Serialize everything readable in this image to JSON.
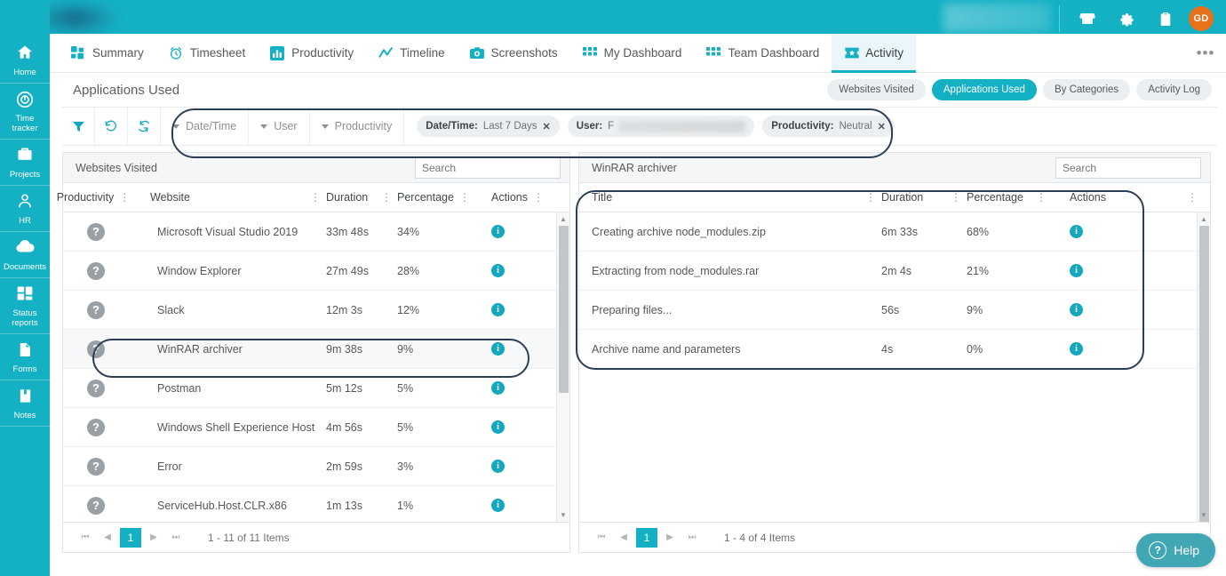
{
  "app": {
    "brand_color": "#14b0c4",
    "accent_color": "#13a8bd",
    "avatar_initials": "GD"
  },
  "topbar": {
    "icons": [
      {
        "name": "storefront-icon",
        "glyph": "⌂"
      },
      {
        "name": "gear-icon",
        "glyph": "⚙"
      },
      {
        "name": "clipboard-icon",
        "glyph": "ὌB"
      }
    ]
  },
  "sidebar": {
    "items": [
      {
        "label": "Home",
        "icon": "home-icon"
      },
      {
        "label": "Time tracker",
        "icon": "time-tracker-icon"
      },
      {
        "label": "Projects",
        "icon": "briefcase-icon"
      },
      {
        "label": "HR",
        "icon": "person-icon"
      },
      {
        "label": "Documents",
        "icon": "cloud-icon"
      },
      {
        "label": "Status reports",
        "icon": "grid-icon"
      },
      {
        "label": "Forms",
        "icon": "document-icon"
      },
      {
        "label": "Notes",
        "icon": "notebook-icon"
      }
    ]
  },
  "tabs": {
    "items": [
      {
        "label": "Summary",
        "icon": "grid-squares-icon",
        "active": false
      },
      {
        "label": "Timesheet",
        "icon": "alarm-clock-icon",
        "active": false
      },
      {
        "label": "Productivity",
        "icon": "bar-chart-icon",
        "active": false
      },
      {
        "label": "Timeline",
        "icon": "trend-line-icon",
        "active": false
      },
      {
        "label": "Screenshots",
        "icon": "camera-icon",
        "active": false
      },
      {
        "label": "My Dashboard",
        "icon": "dashboard-grid-icon",
        "active": false
      },
      {
        "label": "Team Dashboard",
        "icon": "dashboard-grid-icon",
        "active": false
      },
      {
        "label": "Activity",
        "icon": "activity-ticket-icon",
        "active": true
      }
    ],
    "more_label": "•••"
  },
  "page": {
    "title": "Applications Used",
    "view_toggles": [
      {
        "label": "Websites Visited",
        "active": false
      },
      {
        "label": "Applications Used",
        "active": true
      },
      {
        "label": "By Categories",
        "active": false
      },
      {
        "label": "Activity Log",
        "active": false
      }
    ]
  },
  "filterbar": {
    "buttons": [
      {
        "name": "filter-funnel-button",
        "icon": "funnel-icon"
      },
      {
        "name": "reset-button",
        "icon": "undo-icon"
      },
      {
        "name": "refresh-button",
        "icon": "refresh-icon"
      }
    ],
    "dropdowns": [
      {
        "label": "Date/Time"
      },
      {
        "label": "User"
      },
      {
        "label": "Productivity"
      }
    ],
    "chips": [
      {
        "key": "Date/Time:",
        "value": "Last 7 Days",
        "redacted": false,
        "remove": "✕"
      },
      {
        "key": "User:",
        "value": "F",
        "redacted": true,
        "remove": "✕"
      },
      {
        "key": "Productivity:",
        "value": "Neutral",
        "redacted": false,
        "remove": "✕"
      }
    ]
  },
  "left_panel": {
    "title": "Websites Visited",
    "search_placeholder": "Search",
    "search_value": "",
    "columns": [
      "Productivity",
      "Website",
      "Duration",
      "Percentage",
      "Actions"
    ],
    "rows": [
      {
        "productivity": "?",
        "website": "Microsoft Visual Studio 2019",
        "duration": "33m 48s",
        "percentage": "34%",
        "action": "i",
        "highlighted": false
      },
      {
        "productivity": "?",
        "website": "Window Explorer",
        "duration": "27m 49s",
        "percentage": "28%",
        "action": "i",
        "highlighted": false
      },
      {
        "productivity": "?",
        "website": "Slack",
        "duration": "12m 3s",
        "percentage": "12%",
        "action": "i",
        "highlighted": false
      },
      {
        "productivity": "?",
        "website": "WinRAR archiver",
        "duration": "9m 38s",
        "percentage": "9%",
        "action": "i",
        "highlighted": true
      },
      {
        "productivity": "?",
        "website": "Postman",
        "duration": "5m 12s",
        "percentage": "5%",
        "action": "i",
        "highlighted": false
      },
      {
        "productivity": "?",
        "website": "Windows Shell Experience Host",
        "duration": "4m 56s",
        "percentage": "5%",
        "action": "i",
        "highlighted": false
      },
      {
        "productivity": "?",
        "website": "Error",
        "duration": "2m 59s",
        "percentage": "3%",
        "action": "i",
        "highlighted": false
      },
      {
        "productivity": "?",
        "website": "ServiceHub.Host.CLR.x86",
        "duration": "1m 13s",
        "percentage": "1%",
        "action": "i",
        "highlighted": false
      }
    ],
    "pager": {
      "page": "1",
      "summary": "1 - 11 of 11 Items"
    }
  },
  "right_panel": {
    "title": "WinRAR archiver",
    "search_placeholder": "Search",
    "search_value": "",
    "columns": [
      "Title",
      "Duration",
      "Percentage",
      "Actions"
    ],
    "rows": [
      {
        "title": "Creating archive node_modules.zip",
        "duration": "6m 33s",
        "percentage": "68%",
        "action": "i"
      },
      {
        "title": "Extracting from node_modules.rar",
        "duration": "2m 4s",
        "percentage": "21%",
        "action": "i"
      },
      {
        "title": "Preparing files...",
        "duration": "56s",
        "percentage": "9%",
        "action": "i"
      },
      {
        "title": "Archive name and parameters",
        "duration": "4s",
        "percentage": "0%",
        "action": "i"
      }
    ],
    "pager": {
      "page": "1",
      "summary": "1 - 4 of 4 Items"
    }
  },
  "help": {
    "label": "Help",
    "glyph": "?"
  }
}
